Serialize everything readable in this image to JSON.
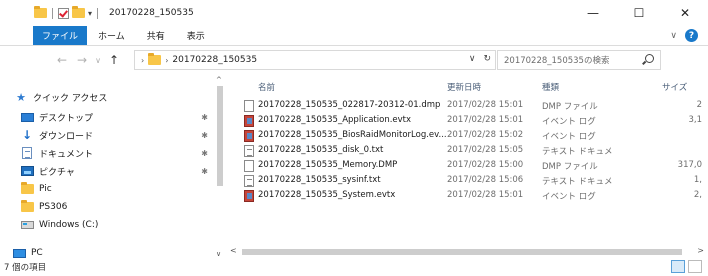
{
  "window": {
    "title": "20170228_150535",
    "minimize_glyph": "—",
    "maximize_glyph": "☐",
    "close_glyph": "✕"
  },
  "ribbon": {
    "tabs": [
      "ファイル",
      "ホーム",
      "共有",
      "表示"
    ],
    "collapse_glyph": "∨",
    "help_glyph": "?"
  },
  "address": {
    "back_glyph": "←",
    "forward_glyph": "→",
    "recent_glyph": "∨",
    "up_glyph": "↑",
    "path_chevron": "›",
    "path": "20170228_150535",
    "dropdown_glyph": "∨",
    "refresh_glyph": "↻",
    "search_placeholder": "20170228_150535の検索"
  },
  "sidebar": {
    "quick_access": "クイック アクセス",
    "items": [
      {
        "label": "デスクトップ",
        "icon": "desktop-icon",
        "pinned": true
      },
      {
        "label": "ダウンロード",
        "icon": "download-icon",
        "pinned": true
      },
      {
        "label": "ドキュメント",
        "icon": "documents-icon",
        "pinned": true
      },
      {
        "label": "ピクチャ",
        "icon": "pictures-icon",
        "pinned": true
      },
      {
        "label": "Pic",
        "icon": "folder-icon",
        "pinned": false
      },
      {
        "label": "PS306",
        "icon": "folder-icon",
        "pinned": false
      },
      {
        "label": "Windows (C:)",
        "icon": "drive-icon",
        "pinned": false
      }
    ],
    "pc": "PC",
    "pin_glyph": "✱"
  },
  "filelist": {
    "columns": {
      "name": "名前",
      "date": "更新日時",
      "type": "種類",
      "size": "サイズ"
    },
    "sort_glyph": "^",
    "rows": [
      {
        "name": "20170228_150535_022817-20312-01.dmp",
        "date": "2017/02/28 15:01",
        "type": "DMP ファイル",
        "size": "2",
        "icon": "dmp"
      },
      {
        "name": "20170228_150535_Application.evtx",
        "date": "2017/02/28 15:01",
        "type": "イベント ログ",
        "size": "3,1",
        "icon": "evtx"
      },
      {
        "name": "20170228_150535_BiosRaidMonitorLog.ev...",
        "date": "2017/02/28 15:02",
        "type": "イベント ログ",
        "size": "",
        "icon": "evtx"
      },
      {
        "name": "20170228_150535_disk_0.txt",
        "date": "2017/02/28 15:05",
        "type": "テキスト ドキュメント",
        "size": "",
        "icon": "txt"
      },
      {
        "name": "20170228_150535_Memory.DMP",
        "date": "2017/02/28 15:00",
        "type": "DMP ファイル",
        "size": "317,0",
        "icon": "dmp"
      },
      {
        "name": "20170228_150535_sysinf.txt",
        "date": "2017/02/28 15:06",
        "type": "テキスト ドキュメント",
        "size": "1,",
        "icon": "txt"
      },
      {
        "name": "20170228_150535_System.evtx",
        "date": "2017/02/28 15:01",
        "type": "イベント ログ",
        "size": "2,",
        "icon": "evtx"
      }
    ]
  },
  "scroll_glyphs": {
    "up": "^",
    "down": "∨",
    "left": "<",
    "right": ">"
  },
  "status": {
    "item_count": "7 個の項目"
  }
}
